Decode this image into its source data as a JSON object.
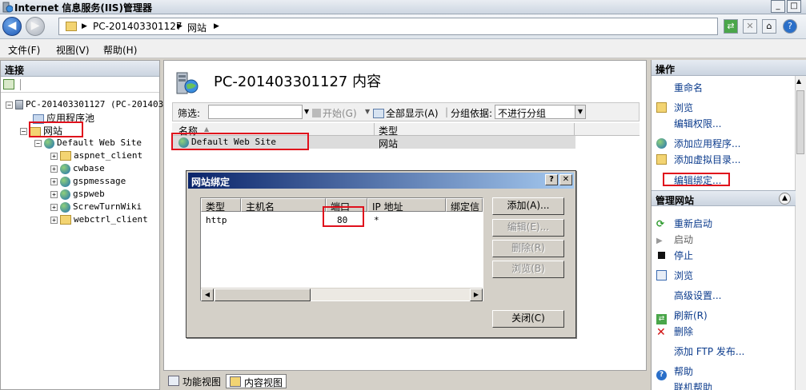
{
  "window": {
    "title": "Internet 信息服务(IIS)管理器"
  },
  "address": {
    "crumbs": [
      "PC-201403301127",
      "网站"
    ],
    "separator": "▶"
  },
  "menu": {
    "items": [
      "文件(F)",
      "视图(V)",
      "帮助(H)"
    ]
  },
  "connections": {
    "header": "连接",
    "tree": {
      "server": "PC-201403301127 (PC-201403",
      "app_pools": "应用程序池",
      "sites": "网站",
      "default_site": "Default Web Site",
      "children": [
        "aspnet_client",
        "cwbase",
        "gspmessage",
        "gspweb",
        "ScrewTurnWiki",
        "webctrl_client"
      ]
    }
  },
  "content": {
    "heading": "PC-201403301127 内容",
    "filter_label": "筛选:",
    "start_label": "开始(G)",
    "show_all_label": "全部显示(A)",
    "group_by_label": "分组依据:",
    "group_by_value": "不进行分组",
    "columns": [
      "名称",
      "类型"
    ],
    "rows": [
      {
        "name": "Default Web Site",
        "type": "网站"
      }
    ]
  },
  "view_tabs": {
    "features": "功能视图",
    "content": "内容视图"
  },
  "actions": {
    "header": "操作",
    "items": [
      "重命名",
      "浏览",
      "编辑权限...",
      "添加应用程序...",
      "添加虚拟目录...",
      "编辑绑定..."
    ],
    "manage_header": "管理网站",
    "manage_items": [
      "重新启动",
      "启动",
      "停止",
      "浏览",
      "高级设置...",
      "刷新(R)",
      "删除",
      "添加 FTP 发布...",
      "帮助",
      "联机帮助"
    ]
  },
  "dialog": {
    "title": "网站绑定",
    "help_btn": "?",
    "close_btn": "✕",
    "columns": [
      "类型",
      "主机名",
      "端口",
      "IP 地址",
      "绑定信"
    ],
    "rows": [
      {
        "type": "http",
        "host": "",
        "port": "80",
        "ip": "*"
      }
    ],
    "buttons": {
      "add": "添加(A)...",
      "edit": "编辑(E)...",
      "remove": "删除(R)",
      "browse": "浏览(B)",
      "close": "关闭(C)"
    }
  },
  "colors": {
    "highlight": "#e0101c",
    "dialog_title_start": "#0a246a",
    "dialog_title_end": "#a6caf0",
    "link": "#0b3b8c"
  }
}
